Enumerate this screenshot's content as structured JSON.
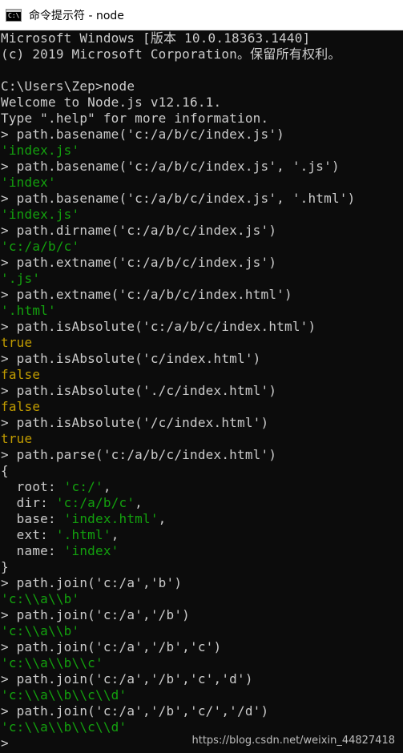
{
  "window": {
    "title": "命令提示符 - node",
    "icon_label": "C:\\"
  },
  "console_lines": [
    [
      {
        "t": "Microsoft Windows [版本 10.0.18363.1440]",
        "c": "norm"
      }
    ],
    [
      {
        "t": "(c) 2019 Microsoft Corporation。保留所有权利。",
        "c": "norm"
      }
    ],
    [],
    [
      {
        "t": "C:\\Users\\Zep>node",
        "c": "norm"
      }
    ],
    [
      {
        "t": "Welcome to Node.js v12.16.1.",
        "c": "norm"
      }
    ],
    [
      {
        "t": "Type \".help\" for more information.",
        "c": "norm"
      }
    ],
    [
      {
        "t": "> path.basename('c:/a/b/c/index.js')",
        "c": "norm"
      }
    ],
    [
      {
        "t": "'index.js'",
        "c": "str"
      }
    ],
    [
      {
        "t": "> path.basename('c:/a/b/c/index.js', '.js')",
        "c": "norm"
      }
    ],
    [
      {
        "t": "'index'",
        "c": "str"
      }
    ],
    [
      {
        "t": "> path.basename('c:/a/b/c/index.js', '.html')",
        "c": "norm"
      }
    ],
    [
      {
        "t": "'index.js'",
        "c": "str"
      }
    ],
    [
      {
        "t": "> path.dirname('c:/a/b/c/index.js')",
        "c": "norm"
      }
    ],
    [
      {
        "t": "'c:/a/b/c'",
        "c": "str"
      }
    ],
    [
      {
        "t": "> path.extname('c:/a/b/c/index.js')",
        "c": "norm"
      }
    ],
    [
      {
        "t": "'.js'",
        "c": "str"
      }
    ],
    [
      {
        "t": "> path.extname('c:/a/b/c/index.html')",
        "c": "norm"
      }
    ],
    [
      {
        "t": "'.html'",
        "c": "str"
      }
    ],
    [
      {
        "t": "> path.isAbsolute('c:/a/b/c/index.html')",
        "c": "norm"
      }
    ],
    [
      {
        "t": "true",
        "c": "bool"
      }
    ],
    [
      {
        "t": "> path.isAbsolute('c/index.html')",
        "c": "norm"
      }
    ],
    [
      {
        "t": "false",
        "c": "bool"
      }
    ],
    [
      {
        "t": "> path.isAbsolute('./c/index.html')",
        "c": "norm"
      }
    ],
    [
      {
        "t": "false",
        "c": "bool"
      }
    ],
    [
      {
        "t": "> path.isAbsolute('/c/index.html')",
        "c": "norm"
      }
    ],
    [
      {
        "t": "true",
        "c": "bool"
      }
    ],
    [
      {
        "t": "> path.parse('c:/a/b/c/index.html')",
        "c": "norm"
      }
    ],
    [
      {
        "t": "{",
        "c": "norm"
      }
    ],
    [
      {
        "t": "  root: ",
        "c": "norm"
      },
      {
        "t": "'c:/'",
        "c": "str"
      },
      {
        "t": ",",
        "c": "norm"
      }
    ],
    [
      {
        "t": "  dir: ",
        "c": "norm"
      },
      {
        "t": "'c:/a/b/c'",
        "c": "str"
      },
      {
        "t": ",",
        "c": "norm"
      }
    ],
    [
      {
        "t": "  base: ",
        "c": "norm"
      },
      {
        "t": "'index.html'",
        "c": "str"
      },
      {
        "t": ",",
        "c": "norm"
      }
    ],
    [
      {
        "t": "  ext: ",
        "c": "norm"
      },
      {
        "t": "'.html'",
        "c": "str"
      },
      {
        "t": ",",
        "c": "norm"
      }
    ],
    [
      {
        "t": "  name: ",
        "c": "norm"
      },
      {
        "t": "'index'",
        "c": "str"
      }
    ],
    [
      {
        "t": "}",
        "c": "norm"
      }
    ],
    [
      {
        "t": "> path.join('c:/a','b')",
        "c": "norm"
      }
    ],
    [
      {
        "t": "'c:\\\\a\\\\b'",
        "c": "str"
      }
    ],
    [
      {
        "t": "> path.join('c:/a','/b')",
        "c": "norm"
      }
    ],
    [
      {
        "t": "'c:\\\\a\\\\b'",
        "c": "str"
      }
    ],
    [
      {
        "t": "> path.join('c:/a','/b','c')",
        "c": "norm"
      }
    ],
    [
      {
        "t": "'c:\\\\a\\\\b\\\\c'",
        "c": "str"
      }
    ],
    [
      {
        "t": "> path.join('c:/a','/b','c','d')",
        "c": "norm"
      }
    ],
    [
      {
        "t": "'c:\\\\a\\\\b\\\\c\\\\d'",
        "c": "str"
      }
    ],
    [
      {
        "t": "> path.join('c:/a','/b','c/','/d')",
        "c": "norm"
      }
    ],
    [
      {
        "t": "'c:\\\\a\\\\b\\\\c\\\\d'",
        "c": "str"
      }
    ],
    [
      {
        "t": ">",
        "c": "norm"
      }
    ]
  ],
  "watermark": "https://blog.csdn.net/weixin_44827418",
  "colors": {
    "background": "#0c0c0c",
    "normal_text": "#cccccc",
    "string_text": "#13a10e",
    "boolean_text": "#c19c00",
    "titlebar": "#ffffff"
  }
}
